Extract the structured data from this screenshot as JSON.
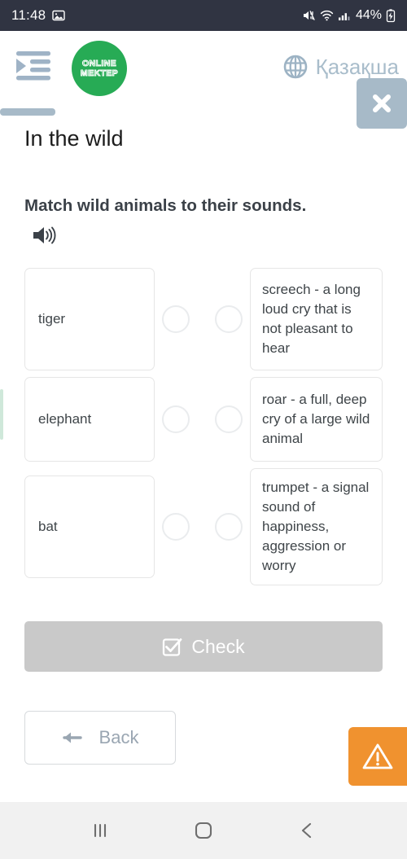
{
  "statusbar": {
    "time": "11:48",
    "icons": [
      "image-icon",
      "mute-icon",
      "wifi-icon",
      "signal-icon",
      "battery-charging-icon"
    ],
    "battery_percent": "44%"
  },
  "header": {
    "menu_icon": "indent-menu-icon",
    "logo": {
      "line1": "ONLINE",
      "line2": "MEKTEP",
      "color": "#27ab55"
    },
    "language": {
      "icon": "globe-icon",
      "label": "Қазақша"
    },
    "close_icon": "close-icon"
  },
  "lesson": {
    "title": "In the wild",
    "instruction": "Match wild animals to their sounds.",
    "audio_icon": "speaker-icon"
  },
  "match_task": {
    "rows": [
      {
        "left": "tiger",
        "right": "screech - a long loud cry that is not pleasant to hear"
      },
      {
        "left": "elephant",
        "right": "roar - a full, deep cry of a large wild animal"
      },
      {
        "left": "bat",
        "right": "trumpet - a signal sound of happiness, aggression or worry"
      }
    ]
  },
  "actions": {
    "check": {
      "label": "Check",
      "icon": "checkbox-checked-icon",
      "enabled": false,
      "color": "#c9c9c9"
    },
    "back": {
      "label": "Back",
      "icon": "arrow-left-icon"
    },
    "report": {
      "icon": "warning-triangle-icon",
      "color": "#f0922f"
    }
  },
  "navbar": {
    "recents_icon": "recents-icon",
    "home_icon": "home-icon",
    "back_icon": "back-chevron-icon"
  }
}
